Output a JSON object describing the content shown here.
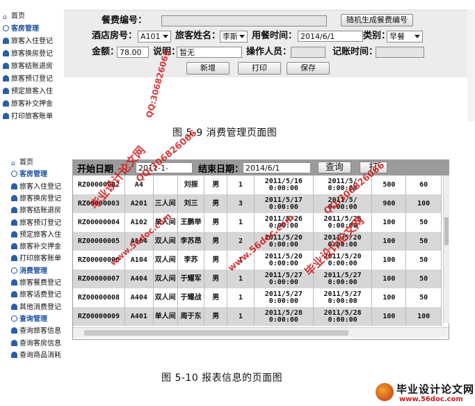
{
  "figure1": {
    "sidebar": [
      {
        "label": "首页",
        "icon": "home-icon",
        "head": false
      },
      {
        "label": "客房管理",
        "icon": "collapse-icon",
        "head": true
      },
      {
        "label": "旅客入住登记",
        "icon": "user-icon",
        "head": false
      },
      {
        "label": "旅客换房登记",
        "icon": "user-icon",
        "head": false
      },
      {
        "label": "旅客结账退房",
        "icon": "user-icon",
        "head": false
      },
      {
        "label": "旅客预订登记",
        "icon": "user-icon",
        "head": false
      },
      {
        "label": "预定旅客入住",
        "icon": "user-icon",
        "head": false
      },
      {
        "label": "旅客补交押金",
        "icon": "user-icon",
        "head": false
      },
      {
        "label": "打印旅客账单",
        "icon": "user-icon",
        "head": false
      }
    ],
    "form": {
      "meal_no_label": "餐费编号：",
      "gen_button": "随机生成餐费编号",
      "room_label": "酒店房号：",
      "room_value": "A101",
      "guest_label": "旅客姓名：",
      "guest_value": "李斯",
      "time_label": "用餐时间：",
      "time_value": "2014/6/1",
      "type_label": "类别：",
      "type_value": "早餐",
      "amount_label": "金额：",
      "amount_value": "78.00",
      "note_label": "说明：",
      "note_value": "暂无",
      "operator_label": "操作人员：",
      "record_label": "记账时间：",
      "buttons": [
        "新增",
        "打印",
        "保存"
      ]
    },
    "caption": "图 5-9 消费管理页面图"
  },
  "figure2": {
    "sidebar": [
      {
        "label": "首页",
        "icon": "home-icon",
        "head": false
      },
      {
        "label": "客房管理",
        "icon": "collapse-icon",
        "head": true
      },
      {
        "label": "旅客入住登记",
        "icon": "user-icon",
        "head": false
      },
      {
        "label": "旅客换房登记",
        "icon": "user-icon",
        "head": false
      },
      {
        "label": "旅客结账退房",
        "icon": "user-icon",
        "head": false
      },
      {
        "label": "旅客预订登记",
        "icon": "user-icon",
        "head": false
      },
      {
        "label": "预定旅客入住",
        "icon": "user-icon",
        "head": false
      },
      {
        "label": "旅客补交押金",
        "icon": "user-icon",
        "head": false
      },
      {
        "label": "打印旅客账单",
        "icon": "user-icon",
        "head": false
      },
      {
        "label": "消费管理",
        "icon": "collapse-icon",
        "head": true
      },
      {
        "label": "旅客餐费登记",
        "icon": "user-icon",
        "head": false
      },
      {
        "label": "旅客话费登记",
        "icon": "user-icon",
        "head": false
      },
      {
        "label": "其他消费登记",
        "icon": "user-icon",
        "head": false
      },
      {
        "label": "查询管理",
        "icon": "collapse-icon",
        "head": true
      },
      {
        "label": "查询旅客信息",
        "icon": "user-icon",
        "head": false
      },
      {
        "label": "查询客房信息",
        "icon": "user-icon",
        "head": false
      },
      {
        "label": "查询商品消耗",
        "icon": "user-icon",
        "head": false
      }
    ],
    "toolbar": {
      "start_label": "开始日期",
      "start_value": "2011-1-",
      "end_label": "结束日期：",
      "end_value": "2014/6/1",
      "query_button": "查询",
      "print_button": "打"
    },
    "rows": [
      [
        "RZ00000002",
        "A4",
        "",
        "刘振",
        "男",
        "1",
        "2011/5/16 0:00:00",
        "2011/5/ 0:00:00",
        "500",
        "60"
      ],
      [
        "RZ00000003",
        "A201",
        "三人间",
        "刘三",
        "男",
        "3",
        "2011/5/17 0:00:00",
        "2011/5/ 0:00:00",
        "900",
        "100"
      ],
      [
        "RZ00000004",
        "A102",
        "单人间",
        "王鹏举",
        "男",
        "1",
        "2011/5/26 0:00:00",
        "2011/5/26 0:00:00",
        "100",
        "50"
      ],
      [
        "RZ00000005",
        "A104",
        "双人间",
        "李苏昂",
        "男",
        "2",
        "2011/5/20 0:00:00",
        "2011/5/20 0:00:00",
        "100",
        "50"
      ],
      [
        "RZ00000006",
        "A104",
        "双人间",
        "李苏",
        "男",
        "1",
        "2011/5/20 0:00:00",
        "2011/5/20 0:00:00",
        "100",
        "50"
      ],
      [
        "RZ00000007",
        "A404",
        "双人间",
        "于耀军",
        "男",
        "1",
        "2011/5/27 0:00:00",
        "2011/5/27 0:00:00",
        "100",
        "50"
      ],
      [
        "RZ00000008",
        "A404",
        "双人间",
        "于耀战",
        "男",
        "1",
        "2011/5/27 0:00:00",
        "2011/5/27 0:00:00",
        "100",
        "50"
      ],
      [
        "RZ00000009",
        "A401",
        "单人间",
        "周于东",
        "男",
        "1",
        "2011/5/28 0:00:00",
        "2011/5/28 0:00:00",
        "100",
        "100"
      ]
    ],
    "caption": "图 5-10 报表信息的页面图"
  },
  "watermarks": {
    "site_cn": "毕业设计论文网",
    "site_url": "www.56doc.com",
    "qq": "QQ:306826066"
  },
  "logo": {
    "title": "毕业设计论文网",
    "url": "www.56doc.com"
  },
  "colors": {
    "watermark": "#d01818",
    "nav_head": "#1c4fa0",
    "toolbar": "#9b9b9b",
    "form_bg": "#ececec"
  }
}
